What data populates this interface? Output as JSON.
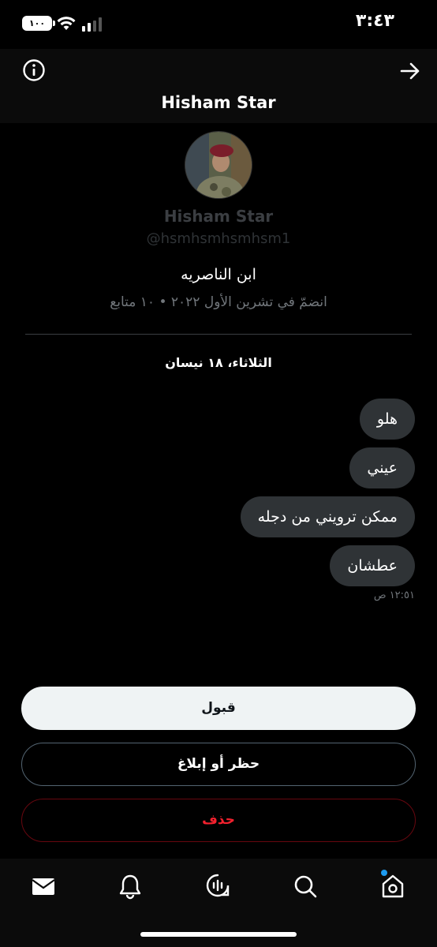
{
  "status_bar": {
    "time": "٣:٤٣",
    "battery": "١٠٠"
  },
  "header": {
    "title": "Hisham Star",
    "info_icon": "info-circle-icon",
    "back_icon": "arrow-right-icon"
  },
  "profile": {
    "name": "Hisham Star",
    "handle": "@hsmhsmhsmhsm1",
    "bio": "ابن الناصريه",
    "meta": "انضمّ في تشرين الأول ٢٠٢٢ • ١٠ متابع"
  },
  "conversation": {
    "date": "الثلاثاء، ١٨ نيسان",
    "messages": [
      {
        "text": "هلو"
      },
      {
        "text": "عيني"
      },
      {
        "text": "ممكن ترويني من دجله"
      },
      {
        "text": "عطشان"
      }
    ],
    "last_time": "١٢:٥١ ص"
  },
  "actions": {
    "accept": "قبول",
    "block_report": "حظر أو إبلاغ",
    "delete": "حذف"
  },
  "colors": {
    "accent": "#1d9bf0",
    "danger": "#f4212e",
    "bubble": "#2f3336"
  },
  "tab_bar": {
    "tabs": [
      {
        "icon": "mail-icon"
      },
      {
        "icon": "bell-icon"
      },
      {
        "icon": "spaces-icon"
      },
      {
        "icon": "search-icon"
      },
      {
        "icon": "home-icon",
        "has_dot": true
      }
    ]
  }
}
